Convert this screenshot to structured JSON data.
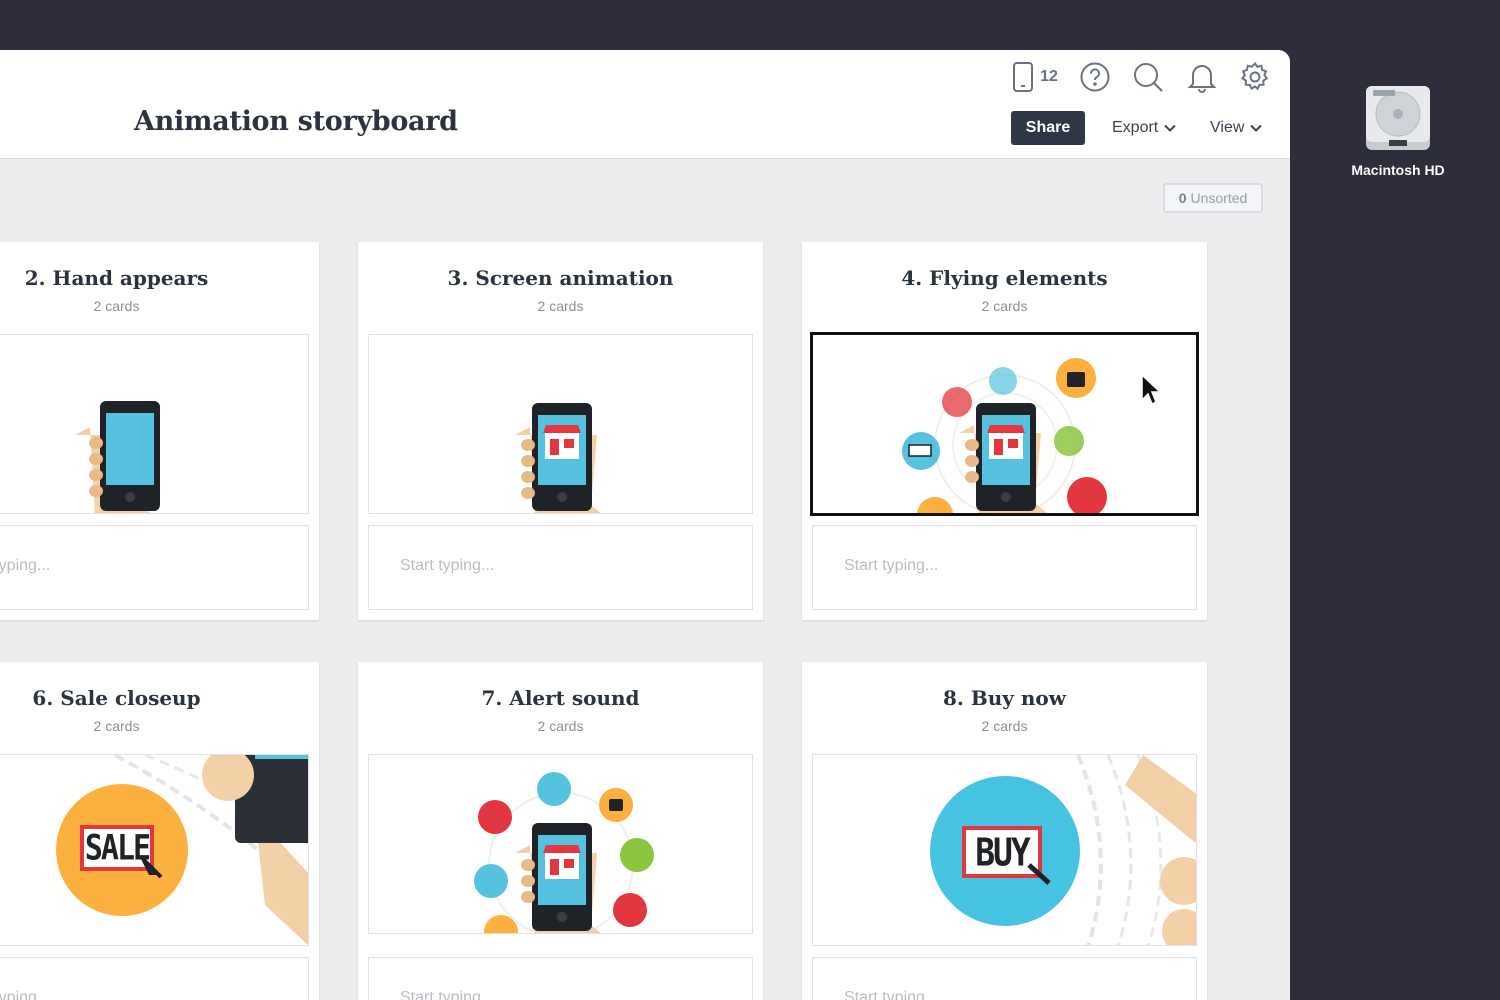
{
  "header": {
    "title": "Animation storyboard",
    "device_count": "12",
    "share_label": "Share",
    "export_label": "Export",
    "view_label": "View"
  },
  "toolbar": {
    "unsorted_count": "0",
    "unsorted_label": "Unsorted"
  },
  "scenes": [
    {
      "title": "2. Hand appears",
      "count": "2 cards",
      "notes_placeholder": "Start typing..."
    },
    {
      "title": "3. Screen animation",
      "count": "2 cards",
      "notes_placeholder": "Start typing..."
    },
    {
      "title": "4. Flying elements",
      "count": "2 cards",
      "notes_placeholder": "Start typing..."
    },
    {
      "title": "6. Sale closeup",
      "count": "2 cards",
      "notes_placeholder": "Start typing..."
    },
    {
      "title": "7. Alert sound",
      "count": "2 cards",
      "notes_placeholder": "Start typing..."
    },
    {
      "title": "8. Buy now",
      "count": "2 cards",
      "notes_placeholder": "Start typing..."
    }
  ],
  "artwork": {
    "sale_text": "SALE",
    "buy_text": "BUY"
  },
  "desktop": {
    "drive_label": "Macintosh HD"
  },
  "colors": {
    "background": "#2d2d3b",
    "primary_button": "#2f3746",
    "screen_blue": "#55c3e0",
    "sale_orange": "#fbb040",
    "buy_blue": "#46c2e2",
    "accent_red": "#e2373f"
  }
}
